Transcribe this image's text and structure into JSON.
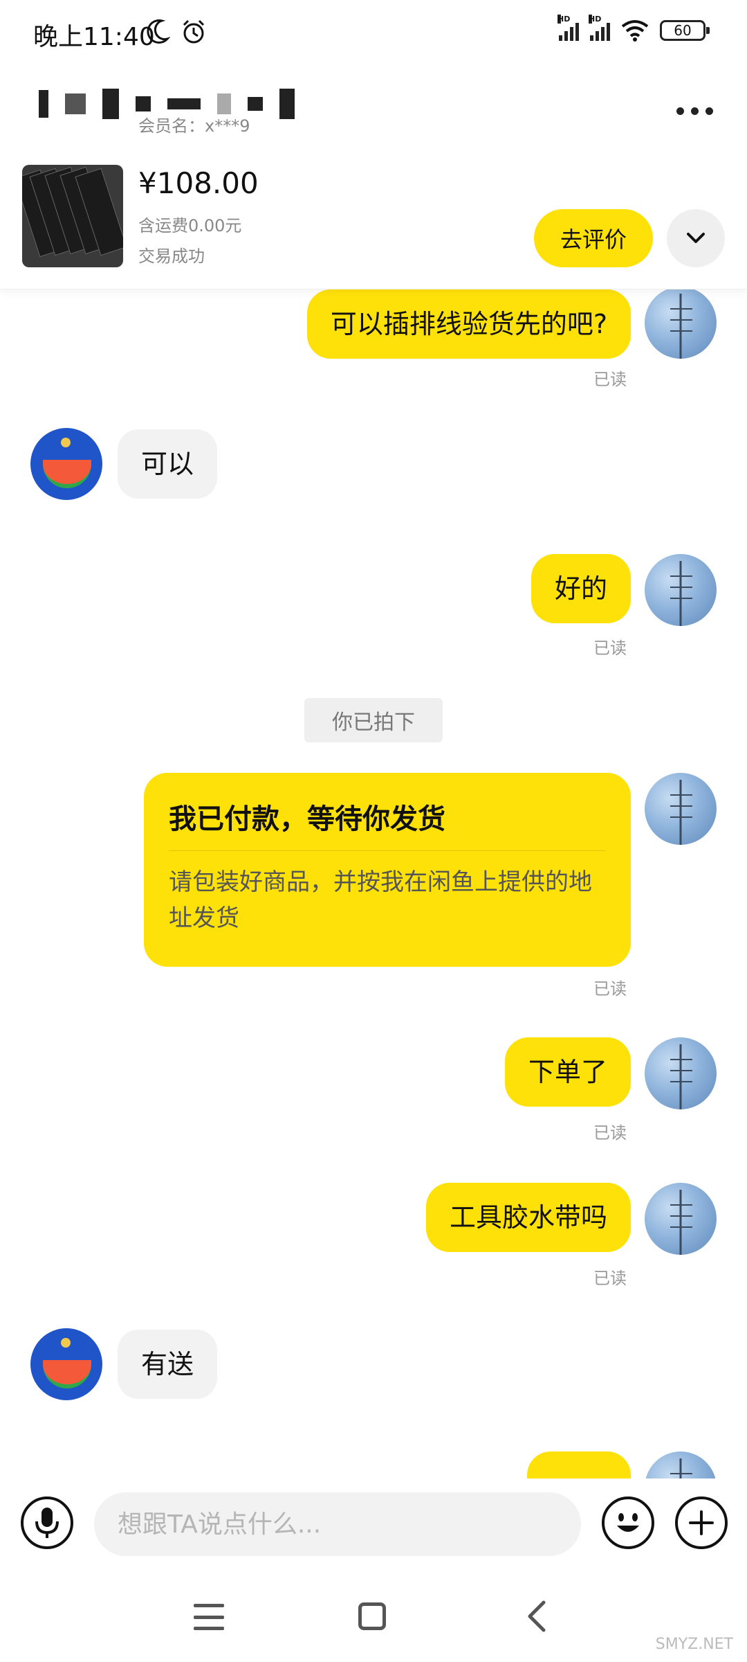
{
  "status_bar": {
    "time": "晚上11:40",
    "signal_label": "HD",
    "battery": "60"
  },
  "header": {
    "member_label": "会员名：x***9",
    "price": "¥108.00",
    "shipping": "含运费0.00元",
    "deal_status": "交易成功",
    "review_button": "去评价"
  },
  "chat": {
    "read_label": "已读",
    "messages": [
      {
        "from": "me",
        "text": "可以插排线验货先的吧?"
      },
      {
        "from": "them",
        "text": "可以"
      },
      {
        "from": "me",
        "text": "好的"
      },
      {
        "from": "system",
        "text": "你已拍下"
      },
      {
        "from": "me",
        "type": "payment_card",
        "title": "我已付款，等待你发货",
        "text": "请包装好商品，并按我在闲鱼上提供的地址发货"
      },
      {
        "from": "me",
        "text": "下单了"
      },
      {
        "from": "me",
        "text": "工具胶水带吗"
      },
      {
        "from": "them",
        "text": "有送"
      }
    ]
  },
  "input": {
    "placeholder": "想跟TA说点什么..."
  },
  "watermark": "SMYZ.NET",
  "colors": {
    "accent": "#ffe10a",
    "bubble_other": "#f2f2f2",
    "muted_text": "#999999"
  }
}
